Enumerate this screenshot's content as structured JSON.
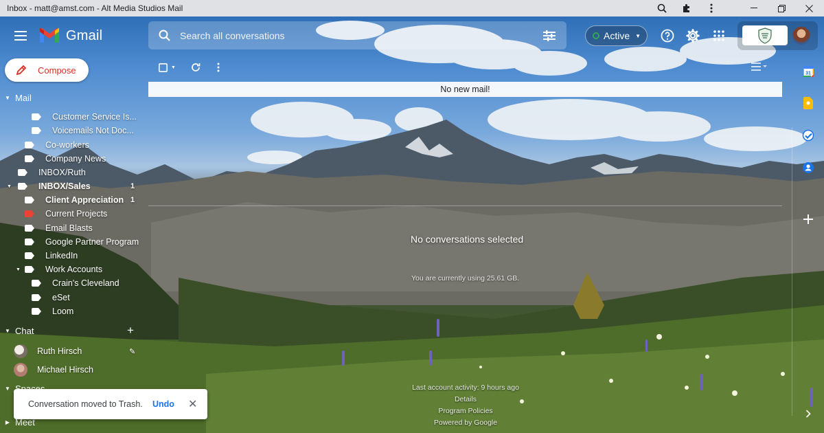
{
  "browser": {
    "title": "Inbox - matt@amst.com - Alt Media Studios Mail",
    "controls": [
      "minimize",
      "restore",
      "close"
    ]
  },
  "header": {
    "brand": "Gmail",
    "search_placeholder": "Search all conversations",
    "status": {
      "label": "Active",
      "color": "#34a853"
    },
    "icons": [
      "menu-icon",
      "search-icon",
      "search-options-icon",
      "help-icon",
      "settings-icon",
      "apps-icon"
    ]
  },
  "sidebar": {
    "compose_label": "Compose",
    "mail_section": "Mail",
    "labels": [
      {
        "name": "Customer Service Is...",
        "color": "#ffffff"
      },
      {
        "name": "Voicemails Not Doc...",
        "color": "#ffffff"
      },
      {
        "name": "Co-workers",
        "color": "#ffffff"
      },
      {
        "name": "Company News",
        "color": "#ffffff"
      },
      {
        "name": "INBOX/Ruth",
        "color": "#ffffff"
      },
      {
        "name": "INBOX/Sales",
        "color": "#ffffff",
        "count": "1"
      },
      {
        "name": "Client Appreciation",
        "color": "#ffffff",
        "count": "1"
      },
      {
        "name": "Current Projects",
        "color": "#ea4335"
      },
      {
        "name": "Email Blasts",
        "color": "#ffffff"
      },
      {
        "name": "Google Partner Program",
        "color": "#ffffff"
      },
      {
        "name": "LinkedIn",
        "color": "#ffffff"
      },
      {
        "name": "Work Accounts",
        "color": "#ffffff"
      },
      {
        "name": "Crain's Cleveland",
        "color": "#ffffff"
      },
      {
        "name": "eSet",
        "color": "#ffffff"
      },
      {
        "name": "Loom",
        "color": "#ffffff"
      }
    ],
    "chat_section": "Chat",
    "chat_people": [
      {
        "name": "Ruth Hirsch"
      },
      {
        "name": "Michael Hirsch"
      }
    ],
    "spaces_section": "Spaces",
    "meet_section": "Meet"
  },
  "main": {
    "banner": "No new mail!",
    "empty_title": "No conversations selected",
    "usage": "You are currently using 25.61 GB.",
    "footer": {
      "activity": "Last account activity: 9 hours ago",
      "details": "Details",
      "policies": "Program Policies",
      "powered": "Powered by Google"
    }
  },
  "side_panel": {
    "apps": [
      "calendar-icon",
      "keep-icon",
      "tasks-icon",
      "contacts-icon",
      "add-icon"
    ],
    "calendar_day": "31"
  },
  "toast": {
    "message": "Conversation moved to Trash.",
    "action": "Undo"
  }
}
